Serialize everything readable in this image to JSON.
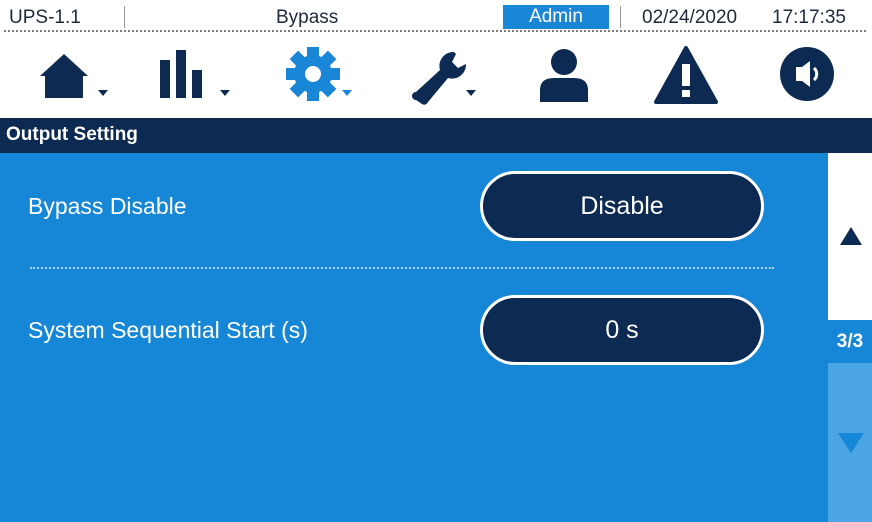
{
  "status_bar": {
    "device": "UPS-1.1",
    "mode": "Bypass",
    "user": "Admin",
    "date": "02/24/2020",
    "time": "17:17:35"
  },
  "nav": {
    "items": [
      {
        "name": "home",
        "icon": "home-icon",
        "has_dropdown": true
      },
      {
        "name": "measurement",
        "icon": "bar-chart-icon",
        "has_dropdown": true
      },
      {
        "name": "settings",
        "icon": "gear-icon",
        "has_dropdown": true,
        "active": true
      },
      {
        "name": "maintenance",
        "icon": "wrench-icon",
        "has_dropdown": true
      },
      {
        "name": "user",
        "icon": "user-icon",
        "has_dropdown": false
      },
      {
        "name": "alarm",
        "icon": "warning-icon",
        "has_dropdown": false
      },
      {
        "name": "sound",
        "icon": "speaker-icon",
        "has_dropdown": false
      }
    ]
  },
  "page": {
    "title": "Output Setting",
    "settings": [
      {
        "label": "Bypass Disable",
        "value": "Disable"
      },
      {
        "label": "System Sequential Start (s)",
        "value": "0 s"
      }
    ],
    "pager": "3/3"
  },
  "colors": {
    "navy": "#0d2a52",
    "panel_blue": "#1686d6",
    "active_icon": "#1a86d8",
    "icon_dark": "#0d2a52"
  }
}
